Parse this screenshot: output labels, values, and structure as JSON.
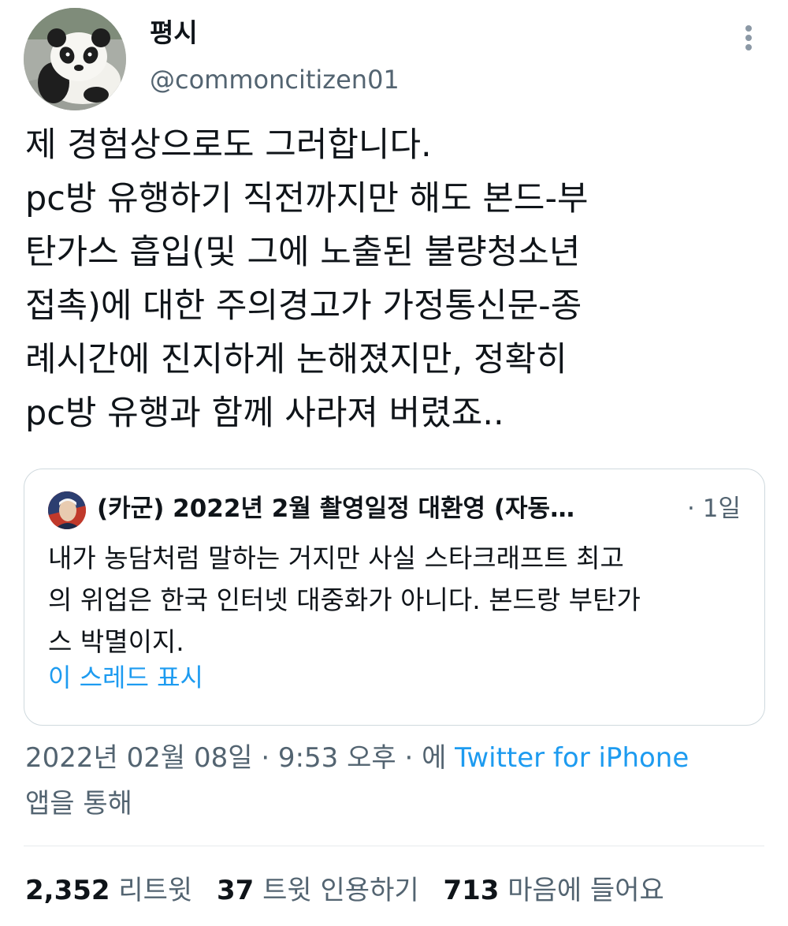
{
  "author": {
    "display_name": "평시",
    "handle": "@commoncitizen01"
  },
  "tweet": {
    "text": "제 경험상으로도 그러합니다.\npc방 유행하기 직전까지만 해도 본드-부\n탄가스 흡입(및 그에 노출된 불량청소년\n접촉)에 대한 주의경고가 가정통신문-종\n례시간에 진지하게 논해졌지만, 정확히\npc방 유행과 함께 사라져 버렸죠.."
  },
  "quoted_tweet": {
    "author_name": "(카군) 2022년 2월 촬영일정 대환영 (자동…",
    "time": "· 1일",
    "text": "내가 농담처럼 말하는 거지만 사실 스타크래프트 최고\n의 위업은 한국 인터넷 대중화가 아니다. 본드랑 부탄가\n스 박멸이지.",
    "show_thread_label": "이 스레드 표시"
  },
  "meta": {
    "timestamp": "2022년 02월 08일 · 9:53 오후 · 에",
    "source": "Twitter for iPhone",
    "via_suffix": "앱을 통해"
  },
  "stats": {
    "retweets_count": "2,352",
    "retweets_label": "리트윗",
    "quotes_count": "37",
    "quotes_label": "트윗 인용하기",
    "likes_count": "713",
    "likes_label": "마음에 들어요"
  },
  "icons": {
    "more": "more-vertical-icon"
  },
  "colors": {
    "link": "#1d9bf0",
    "secondary_text": "#536471",
    "border": "#cfd9de"
  }
}
